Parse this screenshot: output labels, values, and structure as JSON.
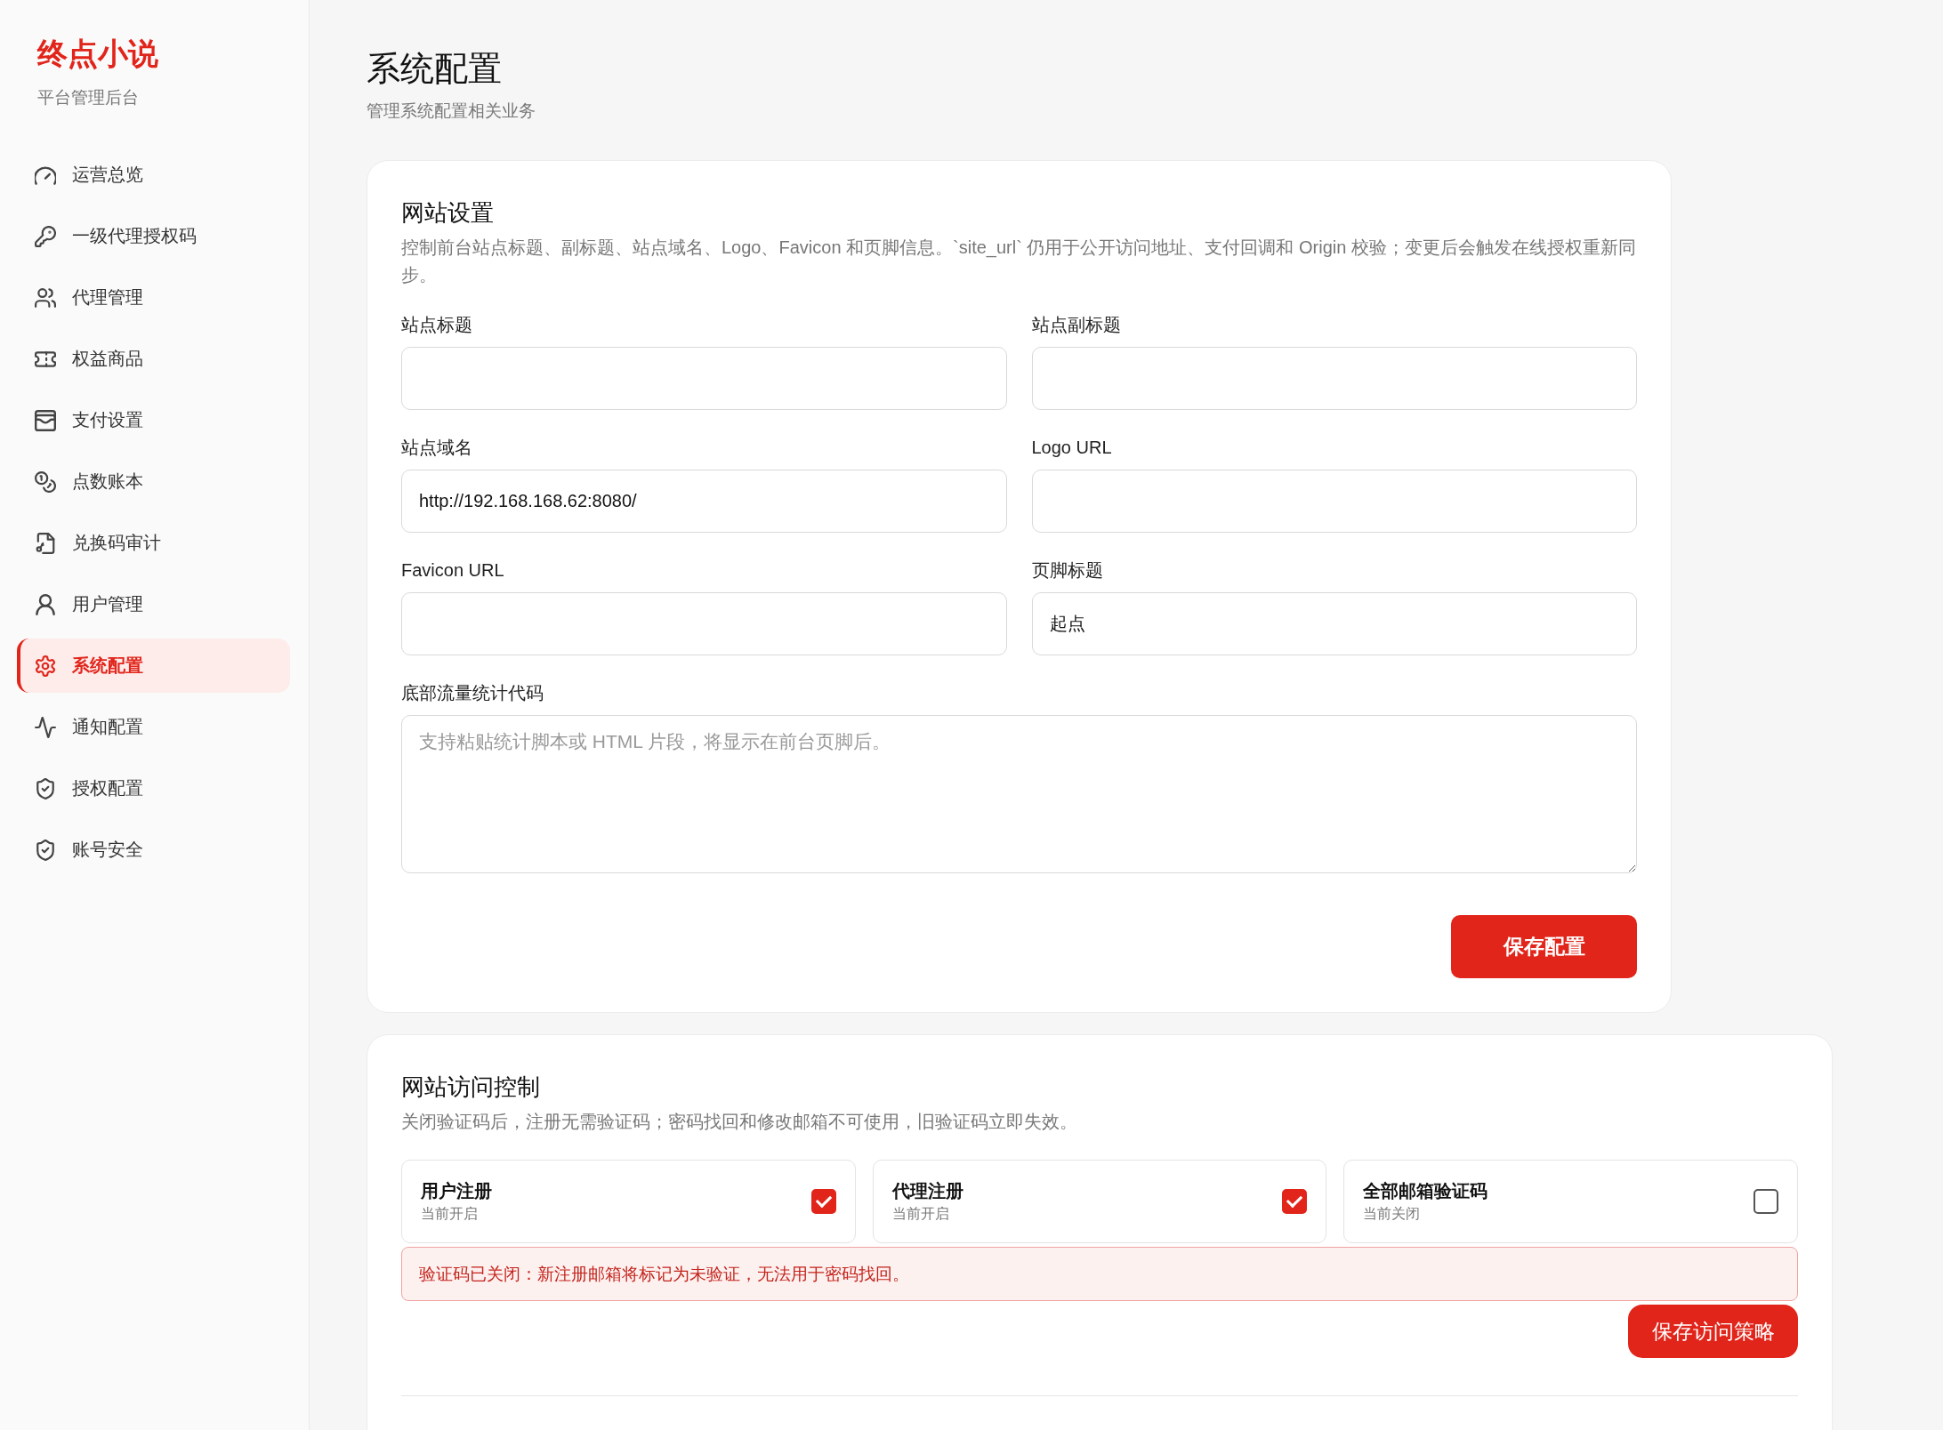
{
  "sidebar": {
    "brand": "终点小说",
    "subtitle": "平台管理后台",
    "items": [
      {
        "label": "运营总览",
        "selected": false
      },
      {
        "label": "一级代理授权码",
        "selected": false
      },
      {
        "label": "代理管理",
        "selected": false
      },
      {
        "label": "权益商品",
        "selected": false
      },
      {
        "label": "支付设置",
        "selected": false
      },
      {
        "label": "点数账本",
        "selected": false
      },
      {
        "label": "兑换码审计",
        "selected": false
      },
      {
        "label": "用户管理",
        "selected": false
      },
      {
        "label": "系统配置",
        "selected": true
      },
      {
        "label": "通知配置",
        "selected": false
      },
      {
        "label": "授权配置",
        "selected": false
      },
      {
        "label": "账号安全",
        "selected": false
      }
    ]
  },
  "page": {
    "title": "系统配置",
    "subtitle": "管理系统配置相关业务"
  },
  "site_settings": {
    "title": "网站设置",
    "description": "控制前台站点标题、副标题、站点域名、Logo、Favicon 和页脚信息。`site_url` 仍用于公开访问地址、支付回调和 Origin 校验；变更后会触发在线授权重新同步。",
    "fields": [
      {
        "label": "站点标题",
        "kind": "input"
      },
      {
        "label": "站点副标题",
        "kind": "input"
      },
      {
        "label": "站点域名",
        "kind": "input",
        "value": "http://192.168.168.62:8080/"
      },
      {
        "label": "Logo URL",
        "kind": "input"
      },
      {
        "label": "Favicon URL",
        "kind": "input"
      },
      {
        "label": "页脚标题",
        "kind": "input",
        "value": "起点"
      },
      {
        "label": "底部流量统计代码",
        "kind": "textarea",
        "placeholder": "支持粘贴统计脚本或 HTML 片段，将显示在前台页脚后。"
      }
    ],
    "save_button": "保存配置"
  },
  "access_control": {
    "title": "网站访问控制",
    "description": "关闭验证码后，注册无需验证码；密码找回和修改邮箱不可使用，旧验证码立即失效。",
    "toggles": [
      {
        "title": "用户注册",
        "status": "当前开启",
        "checked": true
      },
      {
        "title": "代理注册",
        "status": "当前开启",
        "checked": true
      },
      {
        "title": "全部邮箱验证码",
        "status": "当前关闭",
        "checked": false
      }
    ],
    "alert": "验证码已关闭：新注册邮箱将标记为未验证，无法用于密码找回。",
    "save_button": "保存访问策略"
  }
}
